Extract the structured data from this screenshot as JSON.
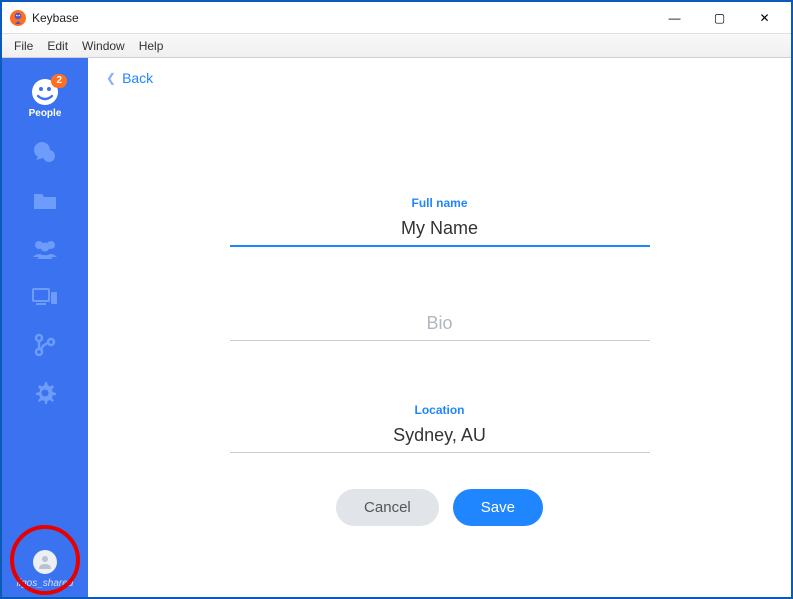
{
  "window": {
    "title": "Keybase",
    "controls": {
      "min": "—",
      "max": "▢",
      "close": "✕"
    }
  },
  "menu": {
    "file": "File",
    "edit": "Edit",
    "window": "Window",
    "help": "Help"
  },
  "sidebar": {
    "people": {
      "label": "People",
      "badge": "2"
    },
    "user": {
      "name": "ligos_shared"
    }
  },
  "content": {
    "back": "Back",
    "fullname_label": "Full name",
    "fullname_value": "My Name",
    "bio_placeholder": "Bio",
    "bio_value": "",
    "location_label": "Location",
    "location_value": "Sydney, AU",
    "cancel": "Cancel",
    "save": "Save"
  }
}
